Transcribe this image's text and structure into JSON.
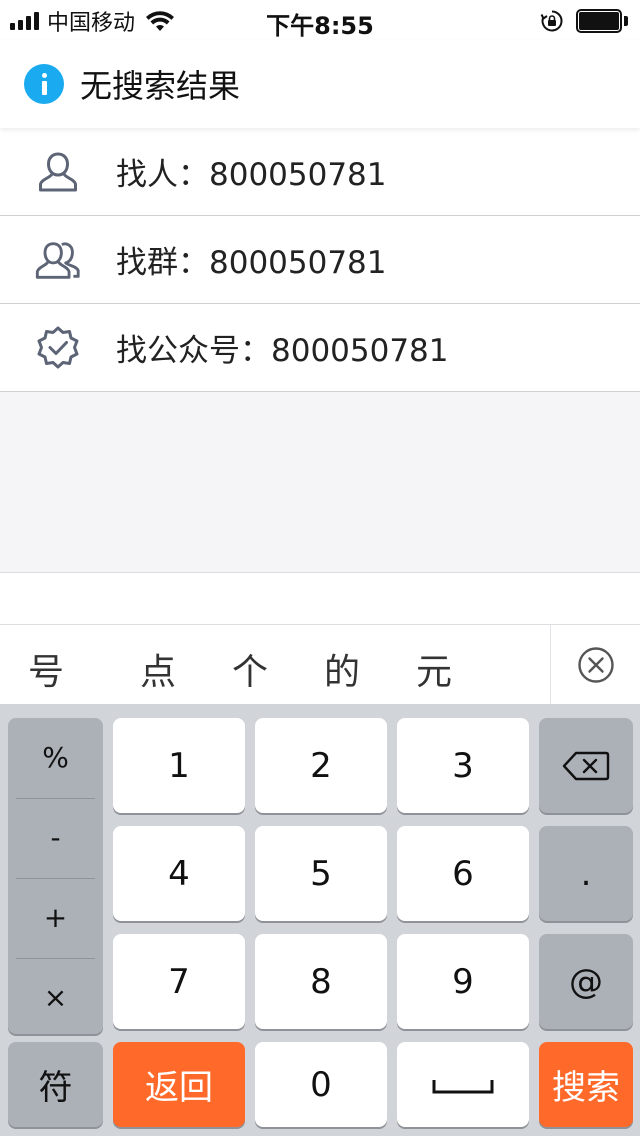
{
  "status_bar": {
    "carrier": "中国移动",
    "time": "下午8:55"
  },
  "header": {
    "title": "无搜索结果",
    "icon": "info-icon"
  },
  "results": [
    {
      "label": "找人：800050781",
      "icon": "person-icon"
    },
    {
      "label": "找群：800050781",
      "icon": "group-icon"
    },
    {
      "label": "找公众号：800050781",
      "icon": "verified-badge-icon"
    }
  ],
  "suggestions": [
    "号",
    "点",
    "个",
    "的",
    "元"
  ],
  "keyboard": {
    "symbols": [
      "%",
      "-",
      "+",
      "×"
    ],
    "digits": [
      "1",
      "2",
      "3",
      "4",
      "5",
      "6",
      "7",
      "8",
      "9",
      "0"
    ],
    "dot": ".",
    "at": "@",
    "fu": "符",
    "back": "返回",
    "search": "搜索"
  },
  "colors": {
    "accent_blue": "#1aaaf0",
    "accent_orange": "#ff6a2a",
    "keyboard_bg": "#d1d4d9"
  }
}
